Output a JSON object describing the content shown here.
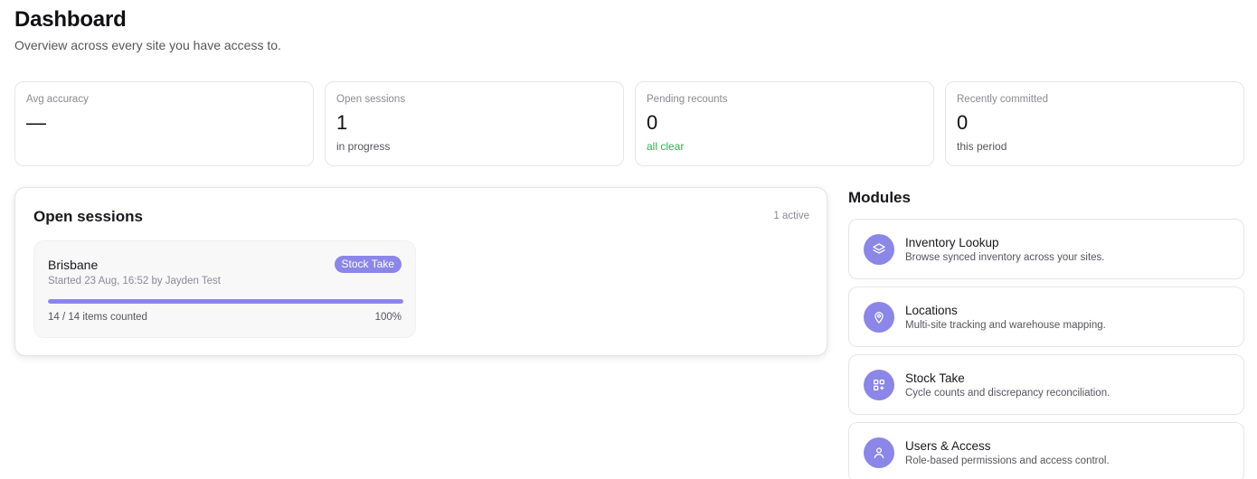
{
  "page": {
    "title": "Dashboard",
    "subtitle": "Overview across every site you have access to."
  },
  "stats": [
    {
      "label": "Avg accuracy",
      "value": "—",
      "note": ""
    },
    {
      "label": "Open sessions",
      "value": "1",
      "note": "in progress"
    },
    {
      "label": "Pending recounts",
      "value": "0",
      "note": "all clear"
    },
    {
      "label": "Recently committed",
      "value": "0",
      "note": "this period"
    }
  ],
  "sessions": {
    "title": "Open sessions",
    "count_label": "1 active",
    "items": [
      {
        "site": "Brisbane",
        "badge": "Stock Take",
        "started": "Started 23 Aug, 16:52 by Jayden Test",
        "counted": "14 / 14 items counted",
        "percent": "100%",
        "progress": 1.0
      }
    ]
  },
  "modules": {
    "title": "Modules",
    "items": [
      {
        "name": "Inventory Lookup",
        "description": "Browse synced inventory across your sites.",
        "icon": "layers-icon"
      },
      {
        "name": "Locations",
        "description": "Multi-site tracking and warehouse mapping.",
        "icon": "map-pin-icon"
      },
      {
        "name": "Stock Take",
        "description": "Cycle counts and discrepancy reconciliation.",
        "icon": "grid-icon"
      },
      {
        "name": "Users & Access",
        "description": "Role-based permissions and access control.",
        "icon": "user-icon"
      }
    ]
  },
  "colors": {
    "accent": "#8b86e8",
    "success": "#2bb24c"
  }
}
